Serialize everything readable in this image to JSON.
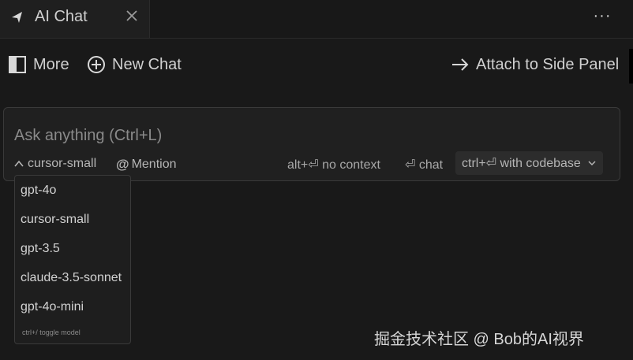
{
  "tab": {
    "title": "AI Chat",
    "icon": "chat-arrow-icon",
    "close_icon": "close-icon"
  },
  "window": {
    "more_menu": "···"
  },
  "toolbar": {
    "more_label": "More",
    "new_chat_label": "New Chat",
    "attach_label": "Attach to Side Panel"
  },
  "input": {
    "placeholder": "Ask anything (Ctrl+L)",
    "selected_model": "cursor-small",
    "mention_label": "Mention",
    "hint_no_context": "alt+⏎ no context",
    "hint_chat": "⏎ chat",
    "hint_codebase": "ctrl+⏎ with codebase"
  },
  "model_dropdown": {
    "options": [
      "gpt-4o",
      "cursor-small",
      "gpt-3.5",
      "claude-3.5-sonnet",
      "gpt-4o-mini"
    ],
    "footer": "ctrl+/ toggle model"
  },
  "watermark": "掘金技术社区 @ Bob的AI视界",
  "edge_glyph": " ",
  "colors": {
    "background": "#191919",
    "panel": "#202020",
    "border": "#3a3a3a",
    "text": "#cfcfcf",
    "muted": "#8a8a8a"
  }
}
